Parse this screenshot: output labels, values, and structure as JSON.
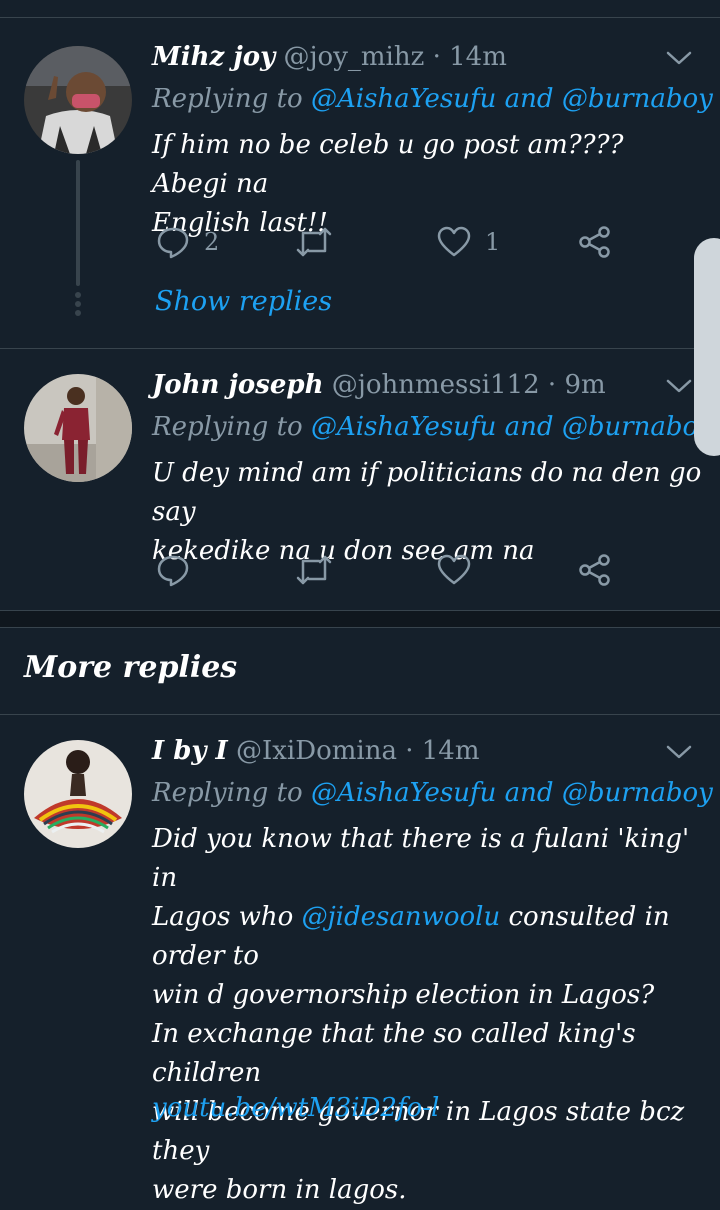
{
  "tweets": [
    {
      "name": "Mihz joy",
      "handle": "@joy_mihz",
      "sep": "·",
      "time": "14m",
      "replying_prefix": "Replying to",
      "mention1": "@AishaYesufu",
      "and": "and",
      "mention2": "@burnaboy",
      "body_line1": "If him no be celeb u go post am???? Abegi na",
      "body_line2": "English last!!",
      "reply_count": "2",
      "retweet_count": "",
      "like_count": "1",
      "show_replies": "Show replies"
    },
    {
      "name": "John joseph",
      "handle": "@johnmessi112",
      "sep": "·",
      "time": "9m",
      "replying_prefix": "Replying to",
      "mention1": "@AishaYesufu",
      "and": "and",
      "mention2": "@burnaboy",
      "body_line1": "U dey mind am if politicians do na den go say",
      "body_line2": "kekedike na u don see am na"
    },
    {
      "name": "I by I",
      "handle": "@IxiDomina",
      "sep": "·",
      "time": "14m",
      "replying_prefix": "Replying to",
      "mention1": "@AishaYesufu",
      "and": "and",
      "mention2": "@burnaboy",
      "body_line1": "Did you know that there is a fulani 'king' in",
      "body_line2_a": "Lagos who",
      "body_line2_mention": "@jidesanwoolu",
      "body_line2_b": "consulted in order to",
      "body_line3": "win d governorship election in Lagos?",
      "body_line4": "In exchange that the so called king's children",
      "body_line5": "will become governor in Lagos state bcz they",
      "body_line6": "were born in lagos.",
      "link_partial": "youtu.be/wtM3iD2fo-l"
    }
  ],
  "section_title": "More replies",
  "icons": {
    "reply": "reply-icon",
    "retweet": "retweet-icon",
    "like": "heart-icon",
    "share": "share-icon",
    "menu": "chevron-down-icon"
  },
  "colors": {
    "background": "#15202b",
    "accent": "#1da1f2",
    "muted": "#8899a6",
    "border": "#38444d"
  }
}
